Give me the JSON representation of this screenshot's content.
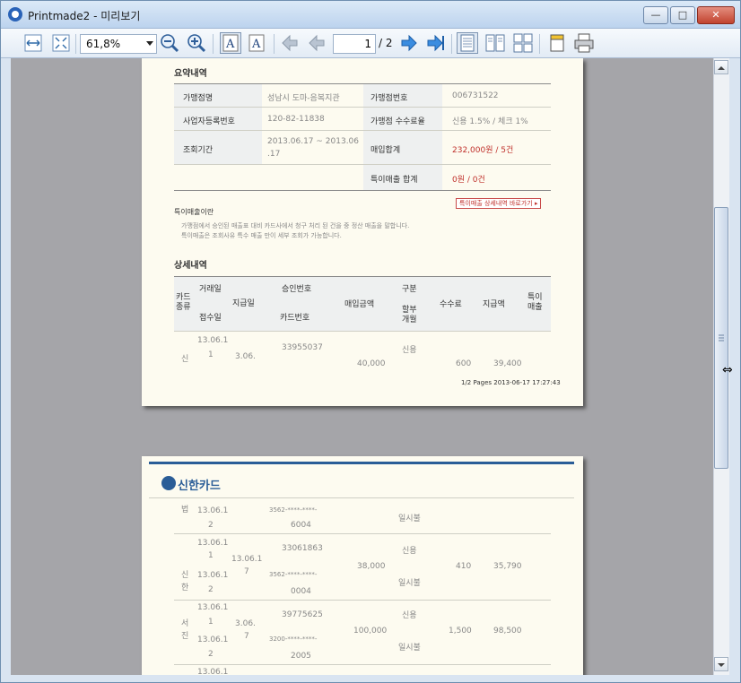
{
  "window": {
    "title": "Printmade2 - 미리보기",
    "minimize_glyph": "—",
    "maximize_glyph": "□",
    "close_glyph": "✕"
  },
  "toolbar": {
    "zoom": "61,8%",
    "current_page": "1",
    "page_total": "/ 2"
  },
  "page1": {
    "summary_title": "요약내역",
    "summary": {
      "merchant_label": "가맹점명",
      "merchant_value": "성남시 도마-음복지관",
      "merchant_no_label": "가맹점번호",
      "merchant_no_value": "006731522",
      "biz_no_label": "사업자등록번호",
      "biz_no_value": "120-82-11838",
      "fee_label": "가맹점 수수료율",
      "fee_value": "신용 1.5% / 체크 1%",
      "period_label": "조회기간",
      "period_value_1": "2013.06.17 ~ 2013.06",
      "period_value_2": ".17",
      "sales_total_label": "매입합계",
      "sales_total_value": "232,000원 / 5건",
      "special_total_label": "특이매출 합계",
      "special_total_value": "0원 / 0건"
    },
    "special_button": "특이매출 상세내역 바로가기 ▸",
    "notice_title": "특이매출이란",
    "notice_line1": "가맹점에서 승인된 매출표 대비 카드사에서 청구 처리 된 건을 중 정산 매출을 말합니다.",
    "notice_line2": "특이매출은 조회사유 특수 매출 만이 세부 조회가 가능합니다.",
    "detail_title": "상세내역",
    "headers": {
      "card_type": "카드\n종류",
      "trade_date": "거래일",
      "receipt_date": "접수일",
      "pay_date": "지급일",
      "approval_no": "승인번호",
      "card_no": "카드번호",
      "purchase_amt": "매입금액",
      "type": "구분",
      "installment": "할부\n개월",
      "fee": "수수료",
      "payment": "지급액",
      "special": "특이\n매출"
    },
    "row1": {
      "card": "신",
      "trade_1": "13.06.1",
      "trade_2": "1",
      "pay": "3.06.",
      "approval": "33955037",
      "amount": "40,000",
      "type": "신용",
      "fee": "600",
      "payment": "39,400"
    },
    "footer": "1/2 Pages 2013-06-17 17:27:43"
  },
  "page2": {
    "brand": "신한카드",
    "rows": [
      {
        "card": "법",
        "trade_a": "13.06.1",
        "trade_b": "2",
        "approval": "3562-****-****-",
        "approval_b": "6004",
        "type": "일시불"
      },
      {
        "card": "신\n한",
        "trade_a": "13.06.1",
        "trade_b": "1",
        "trade_c": "13.06.1",
        "trade_d": "2",
        "pay": "13.06.1",
        "pay_b": "7",
        "approval": "33061863",
        "approval_b": "3562-****-****-",
        "approval_c": "0004",
        "amount": "38,000",
        "type": "신용",
        "type_b": "일시불",
        "fee": "410",
        "payment": "35,790"
      },
      {
        "card": "서\n진",
        "trade_a": "13.06.1",
        "trade_b": "1",
        "trade_c": "13.06.1",
        "trade_d": "2",
        "pay": "3.06.",
        "pay_b": "7",
        "approval": "39775625",
        "approval_b": "3200-****-****-",
        "approval_c": "2005",
        "amount": "100,000",
        "type": "신용",
        "type_b": "일시불",
        "fee": "1,500",
        "payment": "98,500"
      }
    ],
    "last_row_date": "13.06.1"
  },
  "icons": [
    "fit-width-icon",
    "fit-page-icon",
    "zoom-out-icon",
    "zoom-in-icon",
    "text-select-icon",
    "text-edit-icon",
    "first-page-icon",
    "prev-page-icon",
    "next-page-icon",
    "last-page-icon",
    "single-page-icon",
    "two-page-icon",
    "four-page-icon",
    "page-setup-icon",
    "print-icon"
  ],
  "colors": {
    "titlebar": "#bcd3ee",
    "viewport": "#a5a5a9",
    "paper": "#fdfbf0",
    "accent_red": "#c0312c",
    "brand_blue": "#2a5d97"
  }
}
